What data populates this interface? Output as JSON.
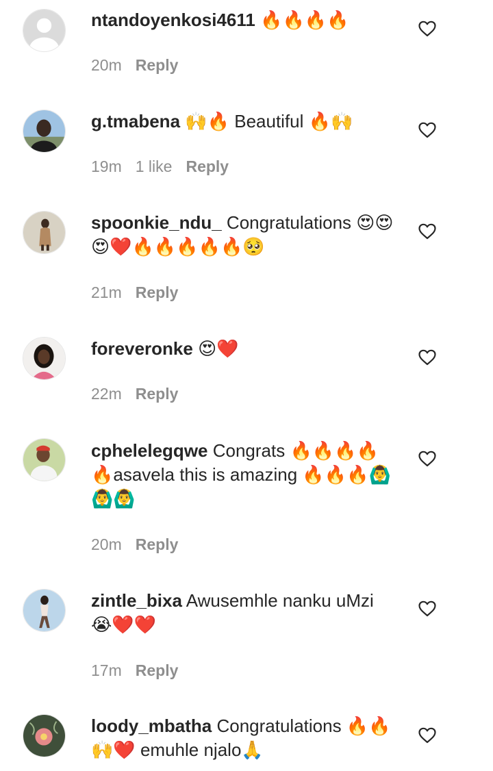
{
  "comments": [
    {
      "username": "ntandoyenkosi4611",
      "text": " 🔥🔥🔥🔥",
      "time": "20m",
      "likes": "",
      "reply_label": "Reply",
      "avatar": "default-avatar"
    },
    {
      "username": "g.tmabena",
      "text": " 🙌🔥 Beautiful 🔥🙌",
      "time": "19m",
      "likes": "1 like",
      "reply_label": "Reply",
      "avatar": "user-photo"
    },
    {
      "username": "spoonkie_ndu_",
      "text": " Congratulations 😍😍😍❤️🔥🔥🔥🔥🔥🥺",
      "time": "21m",
      "likes": "",
      "reply_label": "Reply",
      "avatar": "user-photo"
    },
    {
      "username": "foreveronke",
      "text": " 😍❤️",
      "time": "22m",
      "likes": "",
      "reply_label": "Reply",
      "avatar": "user-photo"
    },
    {
      "username": "cphelelegqwe",
      "text": " Congrats 🔥🔥🔥🔥🔥asavela this is amazing 🔥🔥🔥🙆‍♂️🙆‍♂️🙆‍♂️",
      "time": "20m",
      "likes": "",
      "reply_label": "Reply",
      "avatar": "user-photo"
    },
    {
      "username": "zintle_bixa",
      "text": " Awusemhle nanku uMzi 😭❤️❤️",
      "time": "17m",
      "likes": "",
      "reply_label": "Reply",
      "avatar": "user-photo"
    },
    {
      "username": "loody_mbatha",
      "text": " Congratulations 🔥🔥🙌❤️ emuhle njalo🙏",
      "time": "",
      "likes": "",
      "reply_label": "",
      "avatar": "user-photo"
    }
  ],
  "icons": {
    "like": "heart-outline-icon"
  },
  "colors": {
    "text": "#262626",
    "secondary": "#8e8e8e",
    "background": "#ffffff"
  }
}
